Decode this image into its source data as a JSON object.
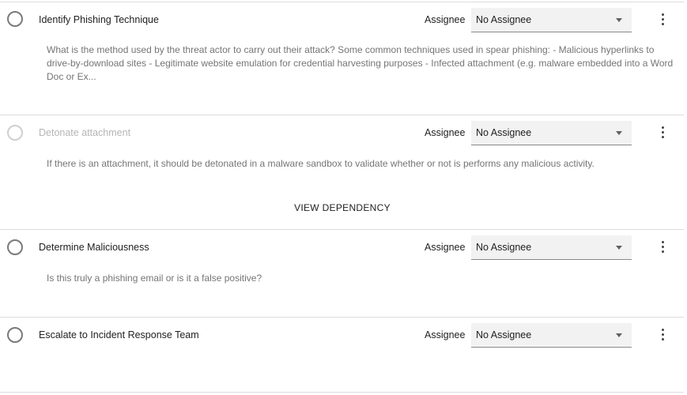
{
  "tasks": [
    {
      "title": "Identify Phishing Technique",
      "assignee_label": "Assignee",
      "assignee_value": "No Assignee",
      "description": "What is the method used by the threat actor to carry out their attack? Some common techniques used in spear phishing: - Malicious hyperlinks to drive-by-download sites - Legitimate website emulation for credential harvesting purposes - Infected attachment (e.g. malware embedded into a Word Doc or Ex...",
      "status": "enabled"
    },
    {
      "title": "Detonate attachment",
      "assignee_label": "Assignee",
      "assignee_value": "No Assignee",
      "description": "If there is an attachment, it should be detonated in a malware sandbox to validate whether or not is performs any malicious activity.",
      "action_label": "VIEW DEPENDENCY",
      "status": "disabled"
    },
    {
      "title": "Determine Maliciousness",
      "assignee_label": "Assignee",
      "assignee_value": "No Assignee",
      "description": "Is this truly a phishing email or is it a false positive?",
      "status": "enabled"
    },
    {
      "title": "Escalate to Incident Response Team",
      "assignee_label": "Assignee",
      "assignee_value": "No Assignee",
      "description": "",
      "status": "enabled"
    }
  ],
  "icons": {
    "status": "radio-circle-icon",
    "menu": "more-vert-icon",
    "dropdown": "caret-down-icon"
  },
  "colors": {
    "text_primary": "#212121",
    "text_secondary": "#757575",
    "text_disabled": "#b5b5b5",
    "divider": "#dcdcdc",
    "select_background": "#f2f2f2"
  }
}
